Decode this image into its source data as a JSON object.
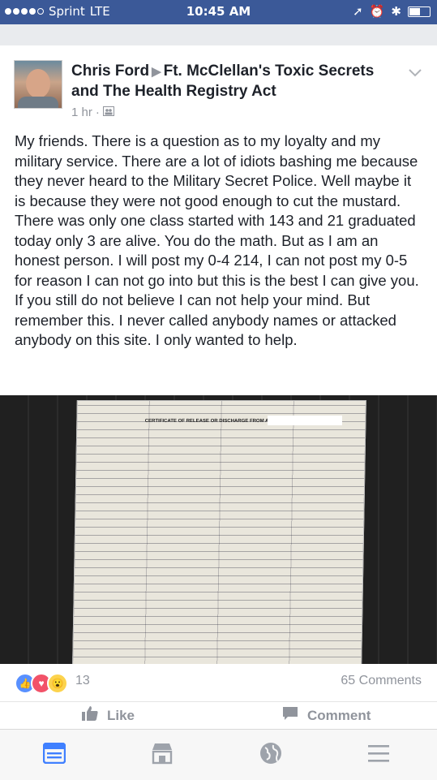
{
  "status_bar": {
    "carrier": "Sprint",
    "network": "LTE",
    "time": "10:45 AM"
  },
  "post": {
    "author": "Chris Ford",
    "group": "Ft. McClellan's Toxic Secrets and The Health Registry Act",
    "time_ago": "1 hr",
    "privacy_icon": "group-icon",
    "text": "My friends. There is a question as to my loyalty and my military service. There are a lot of idiots bashing me because they never heard to the Military Secret Police. Well maybe it is because they were not good enough to cut the mustard. There was only one class started with 143 and 21 graduated today only 3 are alive. You do the math. But as I am an honest person. I will post my 0-4 214, I can not post my 0-5 for reason I can not go into but this is the best I can give you. If you still do not believe I can not help your mind. But remember this. I never called anybody names or attacked anybody on this site. I only wanted to help.",
    "photo_title": "CERTIFICATE OF RELEASE OR DISCHARGE FROM ACTIVE DUTY"
  },
  "reactions": {
    "count": "13",
    "comments": "65 Comments"
  },
  "actions": {
    "like": "Like",
    "comment": "Comment"
  },
  "colors": {
    "brand": "#3b5998",
    "text": "#1d2129",
    "muted": "#90949c",
    "active_tab": "#4080ff"
  },
  "tabs": [
    {
      "icon": "news-feed-icon",
      "active": true
    },
    {
      "icon": "marketplace-icon",
      "active": false
    },
    {
      "icon": "globe-icon",
      "active": false
    },
    {
      "icon": "menu-icon",
      "active": false
    }
  ]
}
